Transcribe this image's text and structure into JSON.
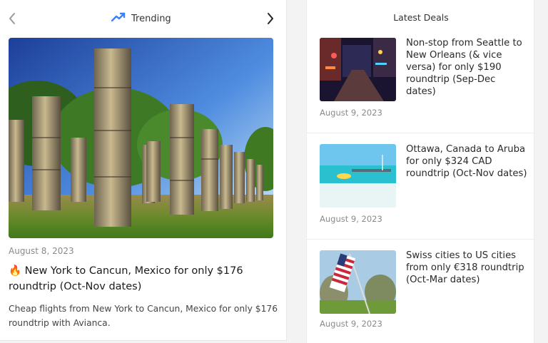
{
  "trending": {
    "title": "Trending",
    "prev_icon": "chevron-left-icon",
    "next_icon": "chevron-right-icon",
    "trend_icon": "trending-up-icon",
    "accent_color": "#3b82f6",
    "article": {
      "date": "August 8, 2023",
      "emoji": "🔥",
      "title": "New York to Cancun, Mexico for only $176 roundtrip (Oct-Nov dates)",
      "description": "Cheap flights from New York to Cancun, Mexico for only $176 roundtrip with Avianca."
    }
  },
  "latest_deals": {
    "title": "Latest Deals",
    "items": [
      {
        "title": "Non-stop from Seattle to New Orleans (& vice versa) for only $190 roundtrip (Sep-Dec dates)",
        "date": "August 9, 2023"
      },
      {
        "title": "Ottawa, Canada to Aruba for only $324 CAD roundtrip (Oct-Nov dates)",
        "date": "August 9, 2023"
      },
      {
        "title": "Swiss cities to US cities from only €318 roundtrip (Oct-Mar dates)",
        "date": "August 9, 2023"
      }
    ]
  }
}
